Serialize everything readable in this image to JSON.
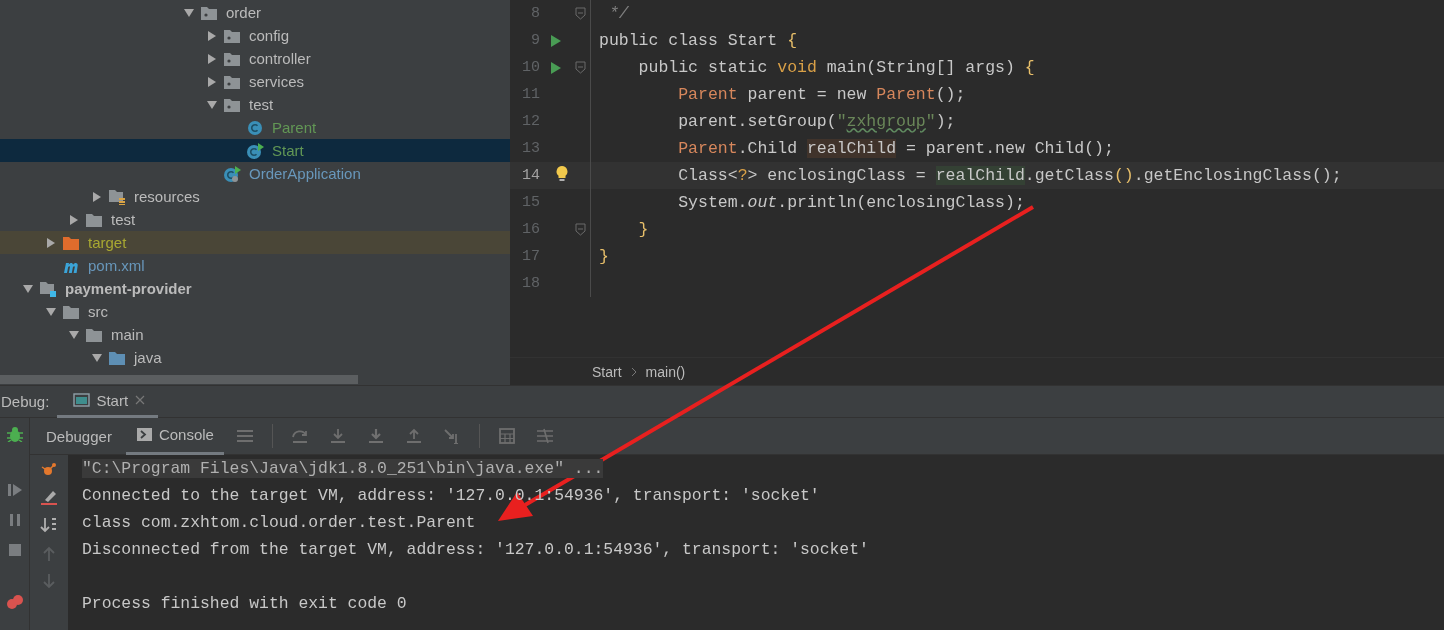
{
  "project_tree": [
    {
      "children": [
        {
          "children": [
            {
              "children": [
                {
                  "children": [
                    {
                      "children": [
                        {
                          "children": [
                            {
                              "children": [
                                {
                                  "label": "order",
                                  "kind": "package",
                                  "expanded": true,
                                  "selected": false,
                                  "children": [
                                    {
                                      "label": "config",
                                      "kind": "package",
                                      "expanded": false,
                                      "selected": false
                                    },
                                    {
                                      "label": "controller",
                                      "kind": "package",
                                      "expanded": false,
                                      "selected": false
                                    },
                                    {
                                      "label": "services",
                                      "kind": "package",
                                      "expanded": false,
                                      "selected": false
                                    },
                                    {
                                      "label": "test",
                                      "kind": "package",
                                      "expanded": true,
                                      "selected": false,
                                      "children": [
                                        {
                                          "label": "Parent",
                                          "kind": "class",
                                          "color": "#629755",
                                          "selected": false
                                        },
                                        {
                                          "label": "Start",
                                          "kind": "runnable-class",
                                          "color": "#629755",
                                          "selected": true
                                        }
                                      ]
                                    },
                                    {
                                      "label": "OrderApplication",
                                      "kind": "spring-class",
                                      "color": "#6897bb",
                                      "selected": false
                                    }
                                  ]
                                }
                              ]
                            }
                          ]
                        }
                      ]
                    }
                  ]
                },
                {
                  "label": "resources",
                  "kind": "resource-folder",
                  "expanded": false,
                  "selected": false
                }
              ]
            },
            {
              "label": "test",
              "kind": "folder",
              "expanded": false,
              "selected": false
            }
          ]
        },
        {
          "label": "target",
          "kind": "excluded-folder",
          "color": "#a8a832",
          "expanded": false,
          "selected": false
        },
        {
          "label": "pom.xml",
          "kind": "maven-file",
          "color": "#6897bb",
          "selected": false
        }
      ]
    },
    {
      "label": "payment-provider",
      "kind": "module",
      "expanded": true,
      "selected": false,
      "children": [
        {
          "label": "src",
          "kind": "folder",
          "expanded": true,
          "selected": false,
          "children": [
            {
              "label": "main",
              "kind": "folder",
              "expanded": true,
              "selected": false,
              "children": [
                {
                  "label": "java",
                  "kind": "source-folder",
                  "expanded": true,
                  "selected": false
                }
              ]
            }
          ]
        }
      ]
    }
  ],
  "editor": {
    "lines": [
      {
        "number": "8",
        "run": false,
        "fold": true,
        "current": false,
        "bulb": false,
        "tokens": [
          {
            "text": " */",
            "kind": "comment"
          }
        ]
      },
      {
        "number": "9",
        "run": true,
        "fold": false,
        "current": false,
        "bulb": false,
        "tokens": [
          {
            "text": "public class Start ",
            "kind": "plain"
          },
          {
            "text": "{",
            "kind": "brace"
          }
        ]
      },
      {
        "number": "10",
        "run": true,
        "fold": true,
        "current": false,
        "bulb": false,
        "tokens": [
          {
            "text": "    public static ",
            "kind": "plain"
          },
          {
            "text": "void",
            "kind": "primitive"
          },
          {
            "text": " main(String[] args) ",
            "kind": "plain"
          },
          {
            "text": "{",
            "kind": "brace"
          }
        ]
      },
      {
        "number": "11",
        "run": false,
        "fold": false,
        "current": false,
        "bulb": false,
        "tokens": [
          {
            "text": "        Parent",
            "kind": "type"
          },
          {
            "text": " parent = new ",
            "kind": "plain"
          },
          {
            "text": "Parent",
            "kind": "type"
          },
          {
            "text": "();",
            "kind": "plain"
          }
        ]
      },
      {
        "number": "12",
        "run": false,
        "fold": false,
        "current": false,
        "bulb": false,
        "tokens": [
          {
            "text": "        parent.setGroup(",
            "kind": "plain"
          },
          {
            "text": "\"",
            "kind": "string"
          },
          {
            "text": "zxhgroup",
            "kind": "typo"
          },
          {
            "text": "\"",
            "kind": "string"
          },
          {
            "text": ");",
            "kind": "plain"
          }
        ]
      },
      {
        "number": "13",
        "run": false,
        "fold": false,
        "current": false,
        "bulb": false,
        "tokens": [
          {
            "text": "        Parent",
            "kind": "type"
          },
          {
            "text": ".Child ",
            "kind": "plain"
          },
          {
            "text": "realChild",
            "kind": "usage"
          },
          {
            "text": " = parent.new Child();",
            "kind": "plain"
          }
        ]
      },
      {
        "number": "14",
        "run": false,
        "fold": false,
        "current": true,
        "bulb": true,
        "tokens": [
          {
            "text": "        Class<",
            "kind": "plain"
          },
          {
            "text": "?",
            "kind": "primitive"
          },
          {
            "text": "> enclosingClass = ",
            "kind": "plain"
          },
          {
            "text": "realChild",
            "kind": "caret-usage"
          },
          {
            "text": ".getClass",
            "kind": "plain"
          },
          {
            "text": "()",
            "kind": "brace"
          },
          {
            "text": ".getEnclosingClass();",
            "kind": "plain"
          }
        ]
      },
      {
        "number": "15",
        "run": false,
        "fold": false,
        "current": false,
        "bulb": false,
        "tokens": [
          {
            "text": "        System.",
            "kind": "plain"
          },
          {
            "text": "out",
            "kind": "static-field"
          },
          {
            "text": ".println(enclosingClass);",
            "kind": "plain"
          }
        ]
      },
      {
        "number": "16",
        "run": false,
        "fold": true,
        "current": false,
        "bulb": false,
        "tokens": [
          {
            "text": "    }",
            "kind": "brace"
          }
        ]
      },
      {
        "number": "17",
        "run": false,
        "fold": false,
        "current": false,
        "bulb": false,
        "tokens": [
          {
            "text": "}",
            "kind": "brace"
          }
        ]
      },
      {
        "number": "18",
        "run": false,
        "fold": false,
        "current": false,
        "bulb": false
      }
    ],
    "breadcrumbs": [
      "Start",
      "main()"
    ]
  },
  "debug": {
    "title": "Debug:",
    "tabs": [
      {
        "label": "Start",
        "selected": true
      }
    ],
    "subtabs": [
      {
        "label": "Debugger",
        "kind": "debugger",
        "selected": false
      },
      {
        "label": "Console",
        "kind": "console",
        "selected": true
      }
    ],
    "console": [
      {
        "kind": "command",
        "text": "\"C:\\Program Files\\Java\\jdk1.8.0_251\\bin\\java.exe\" ..."
      },
      {
        "kind": "output",
        "text": "Connected to the target VM, address: '127.0.0.1:54936', transport: 'socket'"
      },
      {
        "kind": "output",
        "text": "class com.zxhtom.cloud.order.test.Parent"
      },
      {
        "kind": "output",
        "text": "Disconnected from the target VM, address: '127.0.0.1:54936', transport: 'socket'"
      },
      {
        "kind": "blank"
      },
      {
        "kind": "output",
        "text": "Process finished with exit code 0"
      }
    ]
  }
}
